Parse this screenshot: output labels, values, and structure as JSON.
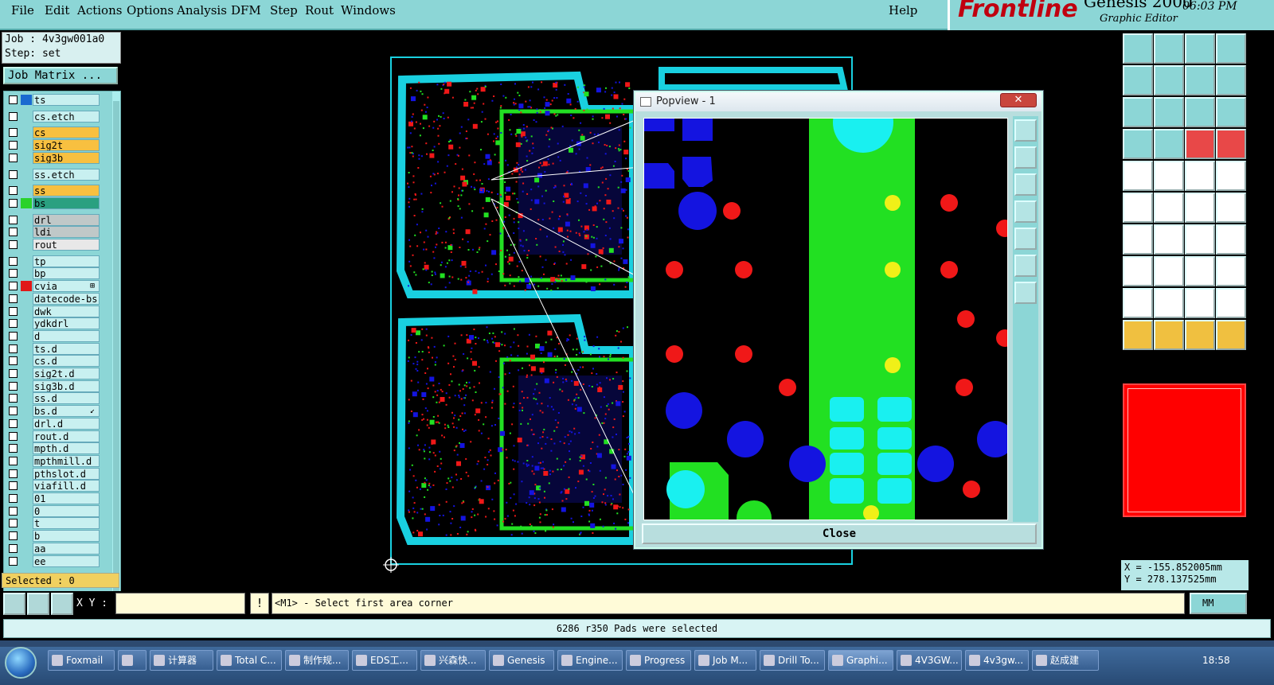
{
  "menu": [
    "File",
    "Edit",
    "Actions",
    "Options",
    "Analysis",
    "DFM",
    "Step",
    "Rout",
    "Windows"
  ],
  "help": "Help",
  "brand": {
    "logo": "Frontline",
    "product": "Genesis 2000",
    "subtitle": "Graphic Editor",
    "clock": "06:03 PM"
  },
  "job": {
    "job_line": "Job : 4v3gw001a0",
    "step_line": "Step: set",
    "matrix_button": "Job Matrix ..."
  },
  "layers": [
    {
      "name": "ts",
      "color": "#1a6ad0",
      "group": 1
    },
    {
      "name": "cs.etch",
      "color": "",
      "group": 2
    },
    {
      "name": "cs",
      "color": "",
      "group": 3,
      "bg": "#f8c040"
    },
    {
      "name": "sig2t",
      "color": "",
      "group": 3,
      "bg": "#f8c040"
    },
    {
      "name": "sig3b",
      "color": "",
      "group": 3,
      "bg": "#f8c040"
    },
    {
      "name": "ss.etch",
      "color": "",
      "group": 4
    },
    {
      "name": "ss",
      "color": "",
      "group": 5,
      "bg": "#f8c040"
    },
    {
      "name": "bs",
      "color": "#2ad22a",
      "group": 5,
      "bg": "#2aa080"
    },
    {
      "name": "drl",
      "color": "",
      "group": 6,
      "bg": "#c0c8c8"
    },
    {
      "name": "ldi",
      "color": "",
      "group": 6,
      "bg": "#c0c8c8"
    },
    {
      "name": "rout",
      "color": "",
      "group": 6,
      "bg": "#e8e8e8"
    },
    {
      "name": "tp",
      "color": "",
      "group": 7
    },
    {
      "name": "bp",
      "color": "",
      "group": 7
    },
    {
      "name": "cvia",
      "color": "#e01818",
      "group": 7,
      "mark": "⊞"
    },
    {
      "name": "datecode-bs",
      "color": "",
      "group": 7
    },
    {
      "name": "dwk",
      "color": "",
      "group": 7
    },
    {
      "name": "ydkdrl",
      "color": "",
      "group": 7
    },
    {
      "name": "d",
      "color": "",
      "group": 7
    },
    {
      "name": "ts.d",
      "color": "",
      "group": 7
    },
    {
      "name": "cs.d",
      "color": "",
      "group": 7
    },
    {
      "name": "sig2t.d",
      "color": "",
      "group": 7
    },
    {
      "name": "sig3b.d",
      "color": "",
      "group": 7
    },
    {
      "name": "ss.d",
      "color": "",
      "group": 7
    },
    {
      "name": "bs.d",
      "color": "",
      "group": 7,
      "mark": "↙"
    },
    {
      "name": "drl.d",
      "color": "",
      "group": 7
    },
    {
      "name": "rout.d",
      "color": "",
      "group": 7
    },
    {
      "name": "mpth.d",
      "color": "",
      "group": 7
    },
    {
      "name": "mpthmill.d",
      "color": "",
      "group": 7
    },
    {
      "name": "pthslot.d",
      "color": "",
      "group": 7
    },
    {
      "name": "viafill.d",
      "color": "",
      "group": 7
    },
    {
      "name": "01",
      "color": "",
      "group": 7
    },
    {
      "name": "0",
      "color": "",
      "group": 7
    },
    {
      "name": "t",
      "color": "",
      "group": 7
    },
    {
      "name": "b",
      "color": "",
      "group": 7
    },
    {
      "name": "aa",
      "color": "",
      "group": 7
    },
    {
      "name": "ee",
      "color": "",
      "group": 7
    }
  ],
  "selected": "Selected : 0",
  "popview": {
    "title": "Popview - 1",
    "close_label": "Close",
    "close_x": "✕"
  },
  "coords": {
    "x": "X = -155.852005mm",
    "y": "Y = 278.137525mm"
  },
  "command": {
    "xy_label": "X Y :",
    "exclaim": "!",
    "prompt": "<M1> - Select first area corner",
    "units": "MM"
  },
  "status": "6286 r350 Pads were selected",
  "taskbar": {
    "tasks": [
      "Foxmail",
      "",
      "计算器",
      "Total C...",
      "制作规...",
      "EDS工...",
      "兴森快...",
      "Genesis",
      "Engine...",
      "Progress",
      "Job M...",
      "Drill To...",
      "Graphi...",
      "4V3GW...",
      "4v3gw...",
      "赵成建"
    ],
    "time": "18:58"
  },
  "colors": {
    "background": "#000000",
    "ui": "#8cd6d6",
    "board_outline": "#19d0e0",
    "copper": "#22e022",
    "pads": "#1414e0",
    "drill": "#f01818"
  }
}
